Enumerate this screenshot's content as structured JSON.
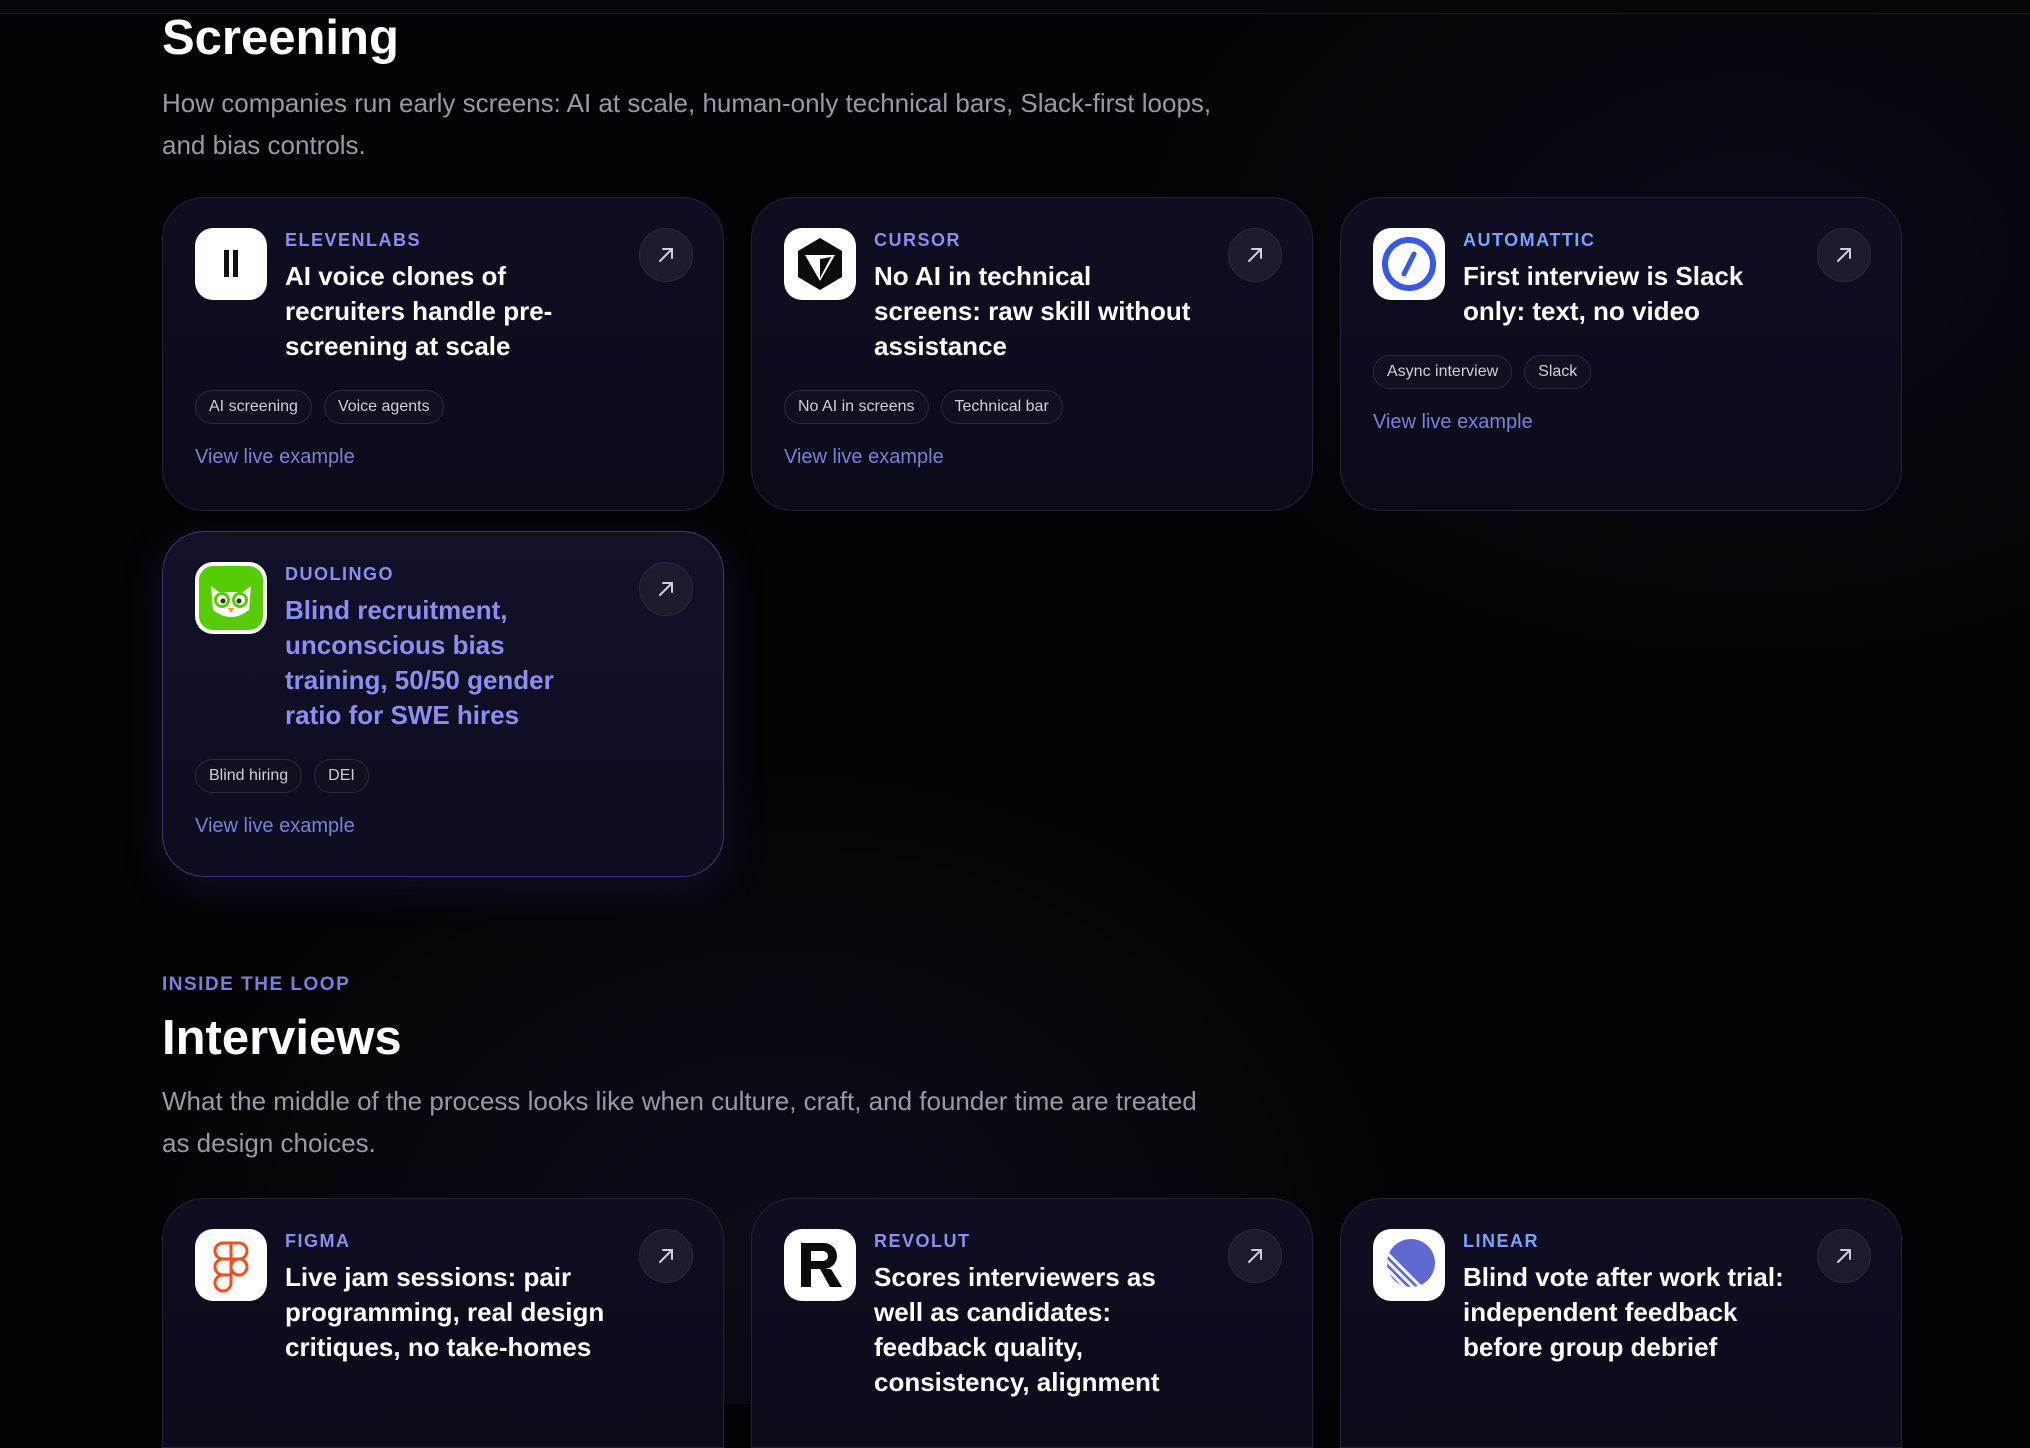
{
  "screening": {
    "title": "Screening",
    "description": "How companies run early screens: AI at scale, human-only technical bars, Slack-first loops, and bias controls.",
    "cards": [
      {
        "company": "ElevenLabs",
        "logo": "elevenlabs-logo-icon",
        "title": "AI voice clones of recruiters handle pre-screening at scale",
        "tags": [
          "AI screening",
          "Voice agents"
        ],
        "link": "View live example"
      },
      {
        "company": "Cursor",
        "logo": "cursor-logo-icon",
        "title": "No AI in technical screens: raw skill without assistance",
        "tags": [
          "No AI in screens",
          "Technical bar"
        ],
        "link": "View live example"
      },
      {
        "company": "Automattic",
        "logo": "automattic-logo-icon",
        "title": "First interview is Slack only: text, no video",
        "tags": [
          "Async interview",
          "Slack"
        ],
        "link": "View live example"
      },
      {
        "company": "Duolingo",
        "logo": "duolingo-logo-icon",
        "title": "Blind recruitment, unconscious bias training, 50/50 gender ratio for SWE hires",
        "tags": [
          "Blind hiring",
          "DEI"
        ],
        "link": "View live example"
      }
    ]
  },
  "interviews": {
    "eyebrow": "INSIDE THE LOOP",
    "title": "Interviews",
    "description": "What the middle of the process looks like when culture, craft, and founder time are treated as design choices.",
    "cards": [
      {
        "company": "Figma",
        "logo": "figma-logo-icon",
        "title": "Live jam sessions: pair programming, real design critiques, no take-homes"
      },
      {
        "company": "Revolut",
        "logo": "revolut-logo-icon",
        "title": "Scores interviewers as well as candidates: feedback quality, consistency, alignment"
      },
      {
        "company": "Linear",
        "logo": "linear-logo-icon",
        "title": "Blind vote after work trial: independent feedback before group debrief"
      }
    ]
  },
  "icons": {
    "arrow": "arrow-up-right-icon"
  },
  "colors": {
    "background": "#030306",
    "accent": "#8b8ff0",
    "automattic_blue": "#3858e9",
    "duolingo_green": "#58cc02",
    "figma_orange": "#f24e1e"
  }
}
